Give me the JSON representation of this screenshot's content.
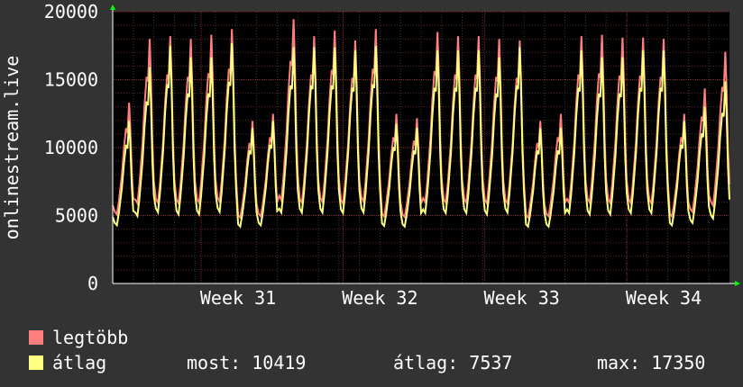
{
  "chart_data": {
    "type": "line",
    "ylabel": "onlinestream.live",
    "ylim": [
      0,
      20000
    ],
    "y_ticks": [
      0,
      5000,
      10000,
      15000,
      20000
    ],
    "y_tick_labels": [
      "0",
      "5000",
      "10000",
      "15000",
      "20000"
    ],
    "x_ticks": [
      "Week 31",
      "Week 32",
      "Week 33",
      "Week 34"
    ],
    "grid": true,
    "series": [
      {
        "name": "legtöbb",
        "color": "#ff7f7f",
        "peak_day_values": [
          12800,
          17300,
          17500,
          17300,
          17600,
          18000,
          11500,
          12000,
          18700,
          17500,
          17900,
          17200,
          18000,
          12000,
          11700,
          17800,
          17500,
          17500,
          17300,
          17200,
          11500,
          12000,
          17500,
          17600,
          17400,
          17400,
          17300,
          12000,
          13800,
          16400
        ]
      },
      {
        "name": "átlag",
        "color": "#ffff80",
        "peak_day_values": [
          11500,
          15300,
          16800,
          16000,
          16000,
          17000,
          11000,
          11500,
          16700,
          16700,
          16700,
          16500,
          16800,
          11300,
          11000,
          16500,
          16500,
          16500,
          16000,
          16700,
          11000,
          11000,
          16500,
          16000,
          16000,
          16500,
          16500,
          11500,
          12500,
          14300
        ]
      }
    ]
  },
  "legend": {
    "max_label": "legtöbb",
    "avg_label": "átlag",
    "max_color": "#ff7f7f",
    "avg_color": "#ffff80"
  },
  "stats": {
    "current": "most: 10419",
    "average": "átlag: 7537",
    "maximum": "max: 17350"
  }
}
